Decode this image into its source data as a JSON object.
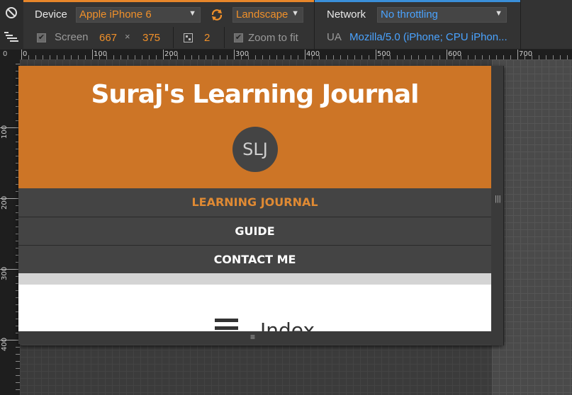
{
  "toolbar": {
    "device_label": "Device",
    "device_value": "Apple iPhone 6",
    "orientation_value": "Landscape",
    "screen_label": "Screen",
    "screen_width": "667",
    "times": "×",
    "screen_height": "375",
    "pixel_ratio": "2",
    "zoom_label": "Zoom to fit",
    "network_label": "Network",
    "network_value": "No throttling",
    "ua_label": "UA",
    "ua_value": "Mozilla/5.0 (iPhone; CPU iPhon..."
  },
  "rulers": {
    "corner": "0",
    "top_labels": [
      "0",
      "100",
      "200",
      "300",
      "400",
      "500",
      "600",
      "700"
    ],
    "left_labels": [
      "100",
      "200",
      "300",
      "400"
    ]
  },
  "page": {
    "site_title": "Suraj's Learning Journal",
    "logo_text": "SLJ",
    "nav": [
      {
        "label": "LEARNING JOURNAL"
      },
      {
        "label": "GUIDE"
      },
      {
        "label": "CONTACT ME"
      }
    ],
    "section_title": "Index"
  },
  "colors": {
    "header_bg": "#cd7526",
    "nav_bg": "#444444",
    "nav_active": "#e08a33",
    "accent_orange": "#e7862a",
    "accent_blue": "#3a8fd9"
  }
}
